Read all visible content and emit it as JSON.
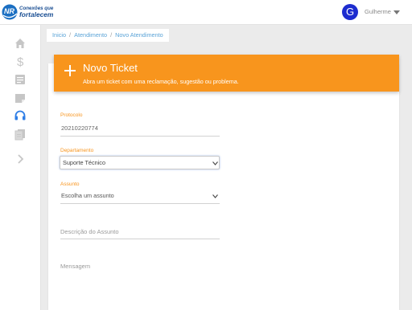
{
  "logo": {
    "initials": "NR",
    "line1": "Conexões que",
    "line2": "fortalecem"
  },
  "user": {
    "initial": "G",
    "name": "Gulherme"
  },
  "sidebar": {
    "items": [
      {
        "icon": "home-icon"
      },
      {
        "icon": "dollar-icon"
      },
      {
        "icon": "document-list-icon"
      },
      {
        "icon": "folded-note-icon"
      },
      {
        "icon": "headset-icon",
        "active": true
      },
      {
        "icon": "stacked-documents-icon"
      },
      {
        "icon": "chevron-right-icon"
      }
    ],
    "active_color": "#2f7ee6",
    "icon_color": "#c6c6c6"
  },
  "breadcrumb": {
    "items": [
      "Inicio",
      "Atendimento",
      "Novo Atendimento"
    ],
    "separator": "/"
  },
  "header": {
    "title": "Novo Ticket",
    "subtitle": "Abra um ticket com uma reclamação, sugestão ou problema.",
    "color": "#f8951d"
  },
  "form": {
    "protocolo": {
      "label": "Protocolo",
      "value": "20210220774"
    },
    "departamento": {
      "label": "Departamento",
      "value": "Suporte Técnico"
    },
    "assunto": {
      "label": "Assunto",
      "value": "Escolha um assunto"
    },
    "descricao": {
      "placeholder": "Descrição do Assunto"
    },
    "mensagem": {
      "placeholder": "Mensagem"
    }
  }
}
